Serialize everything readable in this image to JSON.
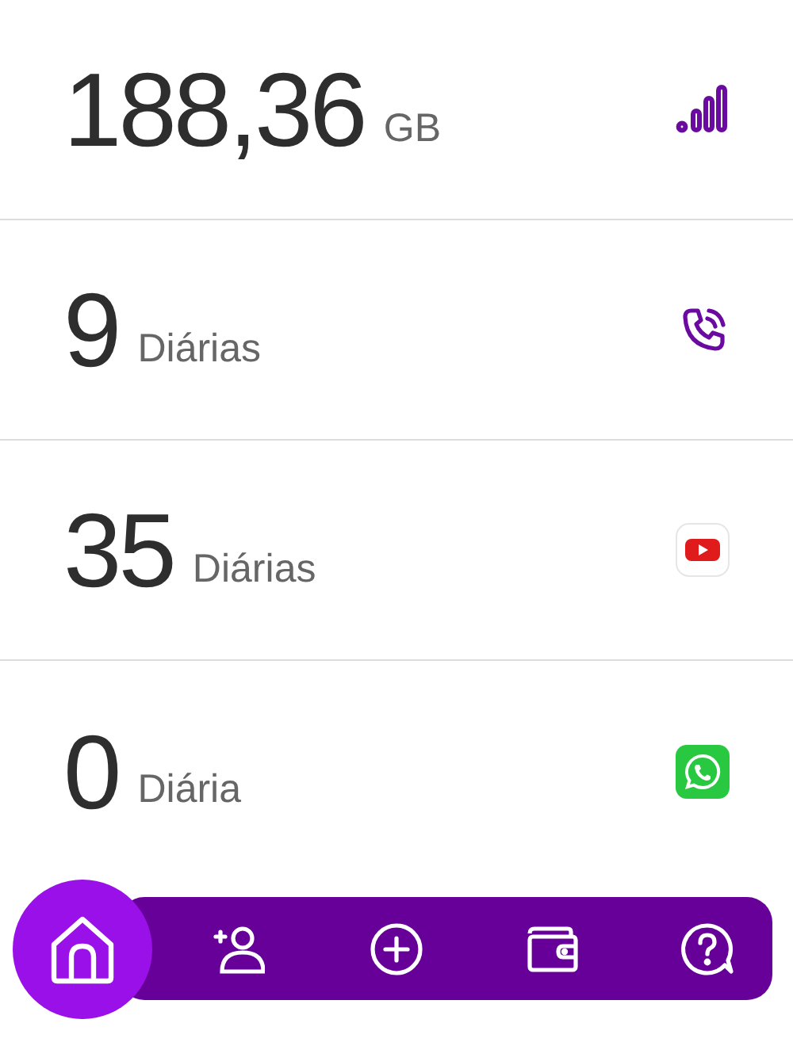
{
  "allowances": [
    {
      "kind": "data",
      "amount": "188,36",
      "unit": "GB"
    },
    {
      "kind": "calls",
      "amount": "9",
      "unit": "Diárias"
    },
    {
      "kind": "video",
      "amount": "35",
      "unit": "Diárias"
    },
    {
      "kind": "chat",
      "amount": "0",
      "unit": "Diária"
    }
  ],
  "bottom_nav": [
    {
      "kind": "home",
      "selected": true
    },
    {
      "kind": "add-person",
      "selected": false
    },
    {
      "kind": "add",
      "selected": false
    },
    {
      "kind": "wallet",
      "selected": false
    },
    {
      "kind": "help",
      "selected": false
    }
  ]
}
